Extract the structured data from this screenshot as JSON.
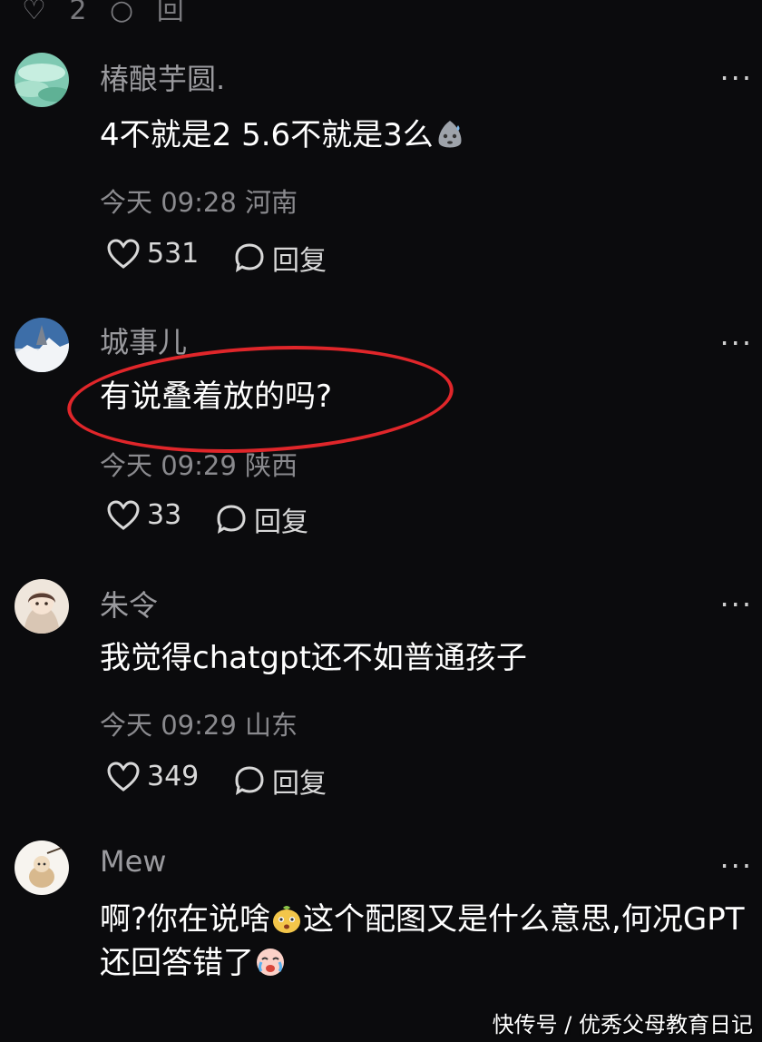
{
  "top_fragment": "♡ 2 ○ 回",
  "comments": [
    {
      "username": "椿酿芋圆.",
      "text": "4不就是2 5.6不就是3么",
      "emoji_icon": "sweat-blob-emoji",
      "time": "今天 09:28 河南",
      "likes": "531",
      "reply_label": "回复",
      "more_label": "···"
    },
    {
      "username": "城事儿",
      "text": "有说叠着放的吗?",
      "time": "今天 09:29 陕西",
      "likes": "33",
      "reply_label": "回复",
      "more_label": "···"
    },
    {
      "username": "朱令",
      "text": "我觉得chatgpt还不如普通孩子",
      "time": "今天 09:29 山东",
      "likes": "349",
      "reply_label": "回复",
      "more_label": "···"
    },
    {
      "username": "Mew",
      "text_part1": "啊?你在说啥",
      "emoji1_icon": "surprised-bun-emoji",
      "text_part2": "这个配图又是什么意思,何况GPT还回答错了",
      "emoji2_icon": "crying-face-emoji",
      "more_label": "···"
    }
  ],
  "annotation_color": "#e0262a",
  "watermark": "快传号 / 优秀父母教育日记"
}
